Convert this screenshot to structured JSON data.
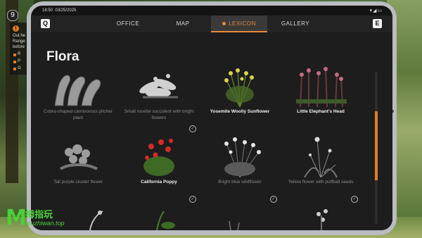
{
  "hud": {
    "badge_number": "9",
    "panel_lines": [
      "Out he",
      "Range",
      "before"
    ],
    "bullets": [
      "R",
      "P",
      "G"
    ]
  },
  "statusbar": {
    "time": "18:50",
    "date": "03/25/2025",
    "sys_icons": "▾◢▭"
  },
  "nav": {
    "left_key": "Q",
    "right_key": "E",
    "tabs": [
      {
        "label": "OFFICE",
        "active": false
      },
      {
        "label": "MAP",
        "active": false
      },
      {
        "label": "LEXICON",
        "active": true
      },
      {
        "label": "GALLERY",
        "active": false
      }
    ]
  },
  "page": {
    "title": "Flora"
  },
  "cards": [
    {
      "label": "Cobra-shaped carnivorous pitcher plant",
      "discovered": false,
      "checked": false,
      "icon": "pitcher-plant"
    },
    {
      "label": "Small rosette succulent with bright flowers",
      "discovered": false,
      "checked": true,
      "icon": "succulent"
    },
    {
      "label": "Yosemite Woolly Sunflower",
      "discovered": true,
      "checked": false,
      "icon": "sunflower"
    },
    {
      "label": "Little Elephant's Head",
      "discovered": true,
      "checked": false,
      "icon": "elephant-head"
    },
    {
      "label": "Tall purple cluster flower",
      "discovered": false,
      "checked": false,
      "icon": "cluster-flower"
    },
    {
      "label": "California Poppy",
      "discovered": true,
      "checked": true,
      "icon": "poppy"
    },
    {
      "label": "Bright blue wildflower",
      "discovered": false,
      "checked": true,
      "icon": "blue-wildflower"
    },
    {
      "label": "Yellow flower with puffball seeds",
      "discovered": false,
      "checked": true,
      "icon": "puffball"
    }
  ],
  "watermark": {
    "letter": "M",
    "line1": "拇指玩",
    "line2": "muzhiwan.top"
  },
  "colors": {
    "accent": "#e98a3a",
    "background": "#1d1d1d",
    "tablet_frame": "#b9bcc1"
  }
}
